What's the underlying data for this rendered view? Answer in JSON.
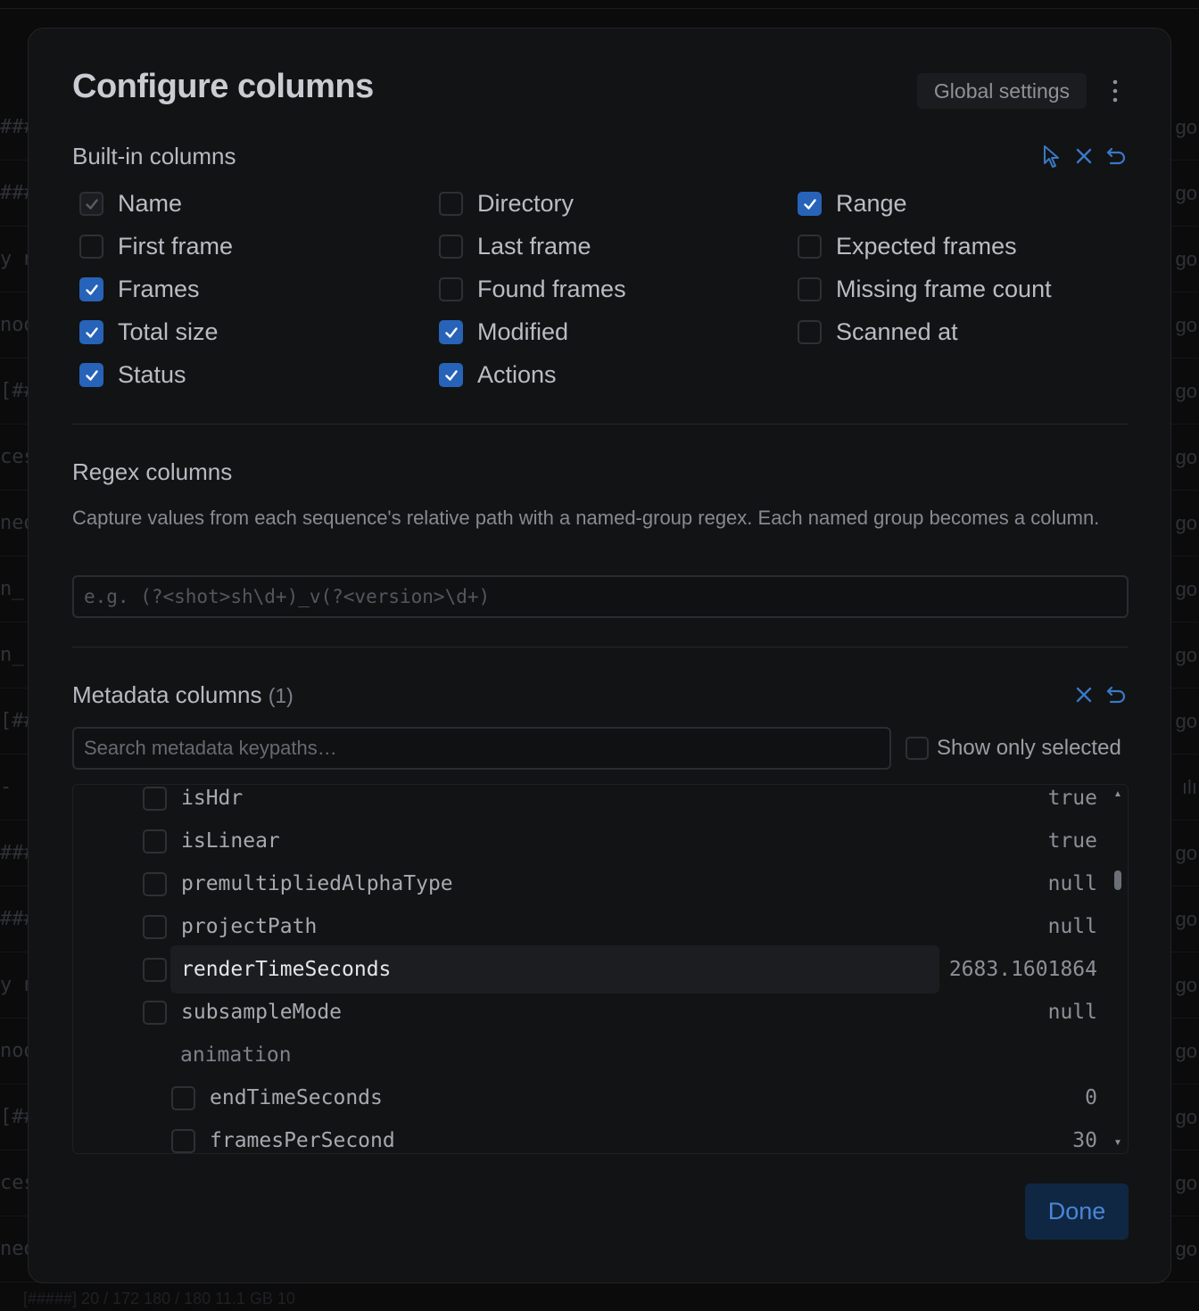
{
  "background": {
    "left_fragments": [
      "###",
      "###",
      "y n",
      "nod",
      "[##",
      "ces",
      "ned",
      "n_[",
      "n_[",
      "[##",
      "-",
      "###",
      "###",
      "y n",
      "nod",
      "[##",
      "ces",
      "ned"
    ],
    "right_fragments": [
      "go",
      "go",
      "go",
      "go",
      "go",
      "go",
      "go",
      "go",
      "go",
      "go",
      "ılı",
      "go",
      "go",
      "go",
      "go",
      "go",
      "go",
      "go"
    ],
    "bottom_text": "[#####]                                                                 20 / 172        180 / 180        11.1 GB        10"
  },
  "modal": {
    "title": "Configure columns",
    "global_settings_label": "Global settings",
    "built_in": {
      "title": "Built-in columns",
      "columns": [
        {
          "label": "Name",
          "checked": true,
          "disabled": true
        },
        {
          "label": "First frame",
          "checked": false
        },
        {
          "label": "Frames",
          "checked": true
        },
        {
          "label": "Total size",
          "checked": true
        },
        {
          "label": "Status",
          "checked": true
        },
        {
          "label": "Directory",
          "checked": false
        },
        {
          "label": "Last frame",
          "checked": false
        },
        {
          "label": "Found frames",
          "checked": false
        },
        {
          "label": "Modified",
          "checked": true
        },
        {
          "label": "Actions",
          "checked": true
        },
        {
          "label": "Range",
          "checked": true
        },
        {
          "label": "Expected frames",
          "checked": false
        },
        {
          "label": "Missing frame count",
          "checked": false
        },
        {
          "label": "Scanned at",
          "checked": false
        }
      ]
    },
    "regex": {
      "title": "Regex columns",
      "help": "Capture values from each sequence's relative path with a named-group regex. Each named group becomes a column.",
      "placeholder": "e.g. (?<shot>sh\\d+)_v(?<version>\\d+)"
    },
    "metadata": {
      "title": "Metadata columns",
      "count": "(1)",
      "search_placeholder": "Search metadata keypaths…",
      "show_only_selected_label": "Show only selected",
      "rows": [
        {
          "key": "isHdr",
          "value": "true",
          "type": "item",
          "indent": 0
        },
        {
          "key": "isLinear",
          "value": "true",
          "type": "item",
          "indent": 0
        },
        {
          "key": "premultipliedAlphaType",
          "value": "null",
          "type": "item",
          "indent": 0
        },
        {
          "key": "projectPath",
          "value": "null",
          "type": "item",
          "indent": 0
        },
        {
          "key": "renderTimeSeconds",
          "value": "2683.1601864",
          "type": "item",
          "indent": 0,
          "highlighted": true
        },
        {
          "key": "subsampleMode",
          "value": "null",
          "type": "item",
          "indent": 0
        },
        {
          "key": "animation",
          "value": "",
          "type": "group",
          "indent": 0
        },
        {
          "key": "endTimeSeconds",
          "value": "0",
          "type": "item",
          "indent": 1
        },
        {
          "key": "framesPerSecond",
          "value": "30",
          "type": "item",
          "indent": 1
        }
      ]
    },
    "done_label": "Done"
  },
  "colors": {
    "accent": "#2763b8",
    "modal_bg": "#121314",
    "page_bg": "#0b0b0c"
  }
}
